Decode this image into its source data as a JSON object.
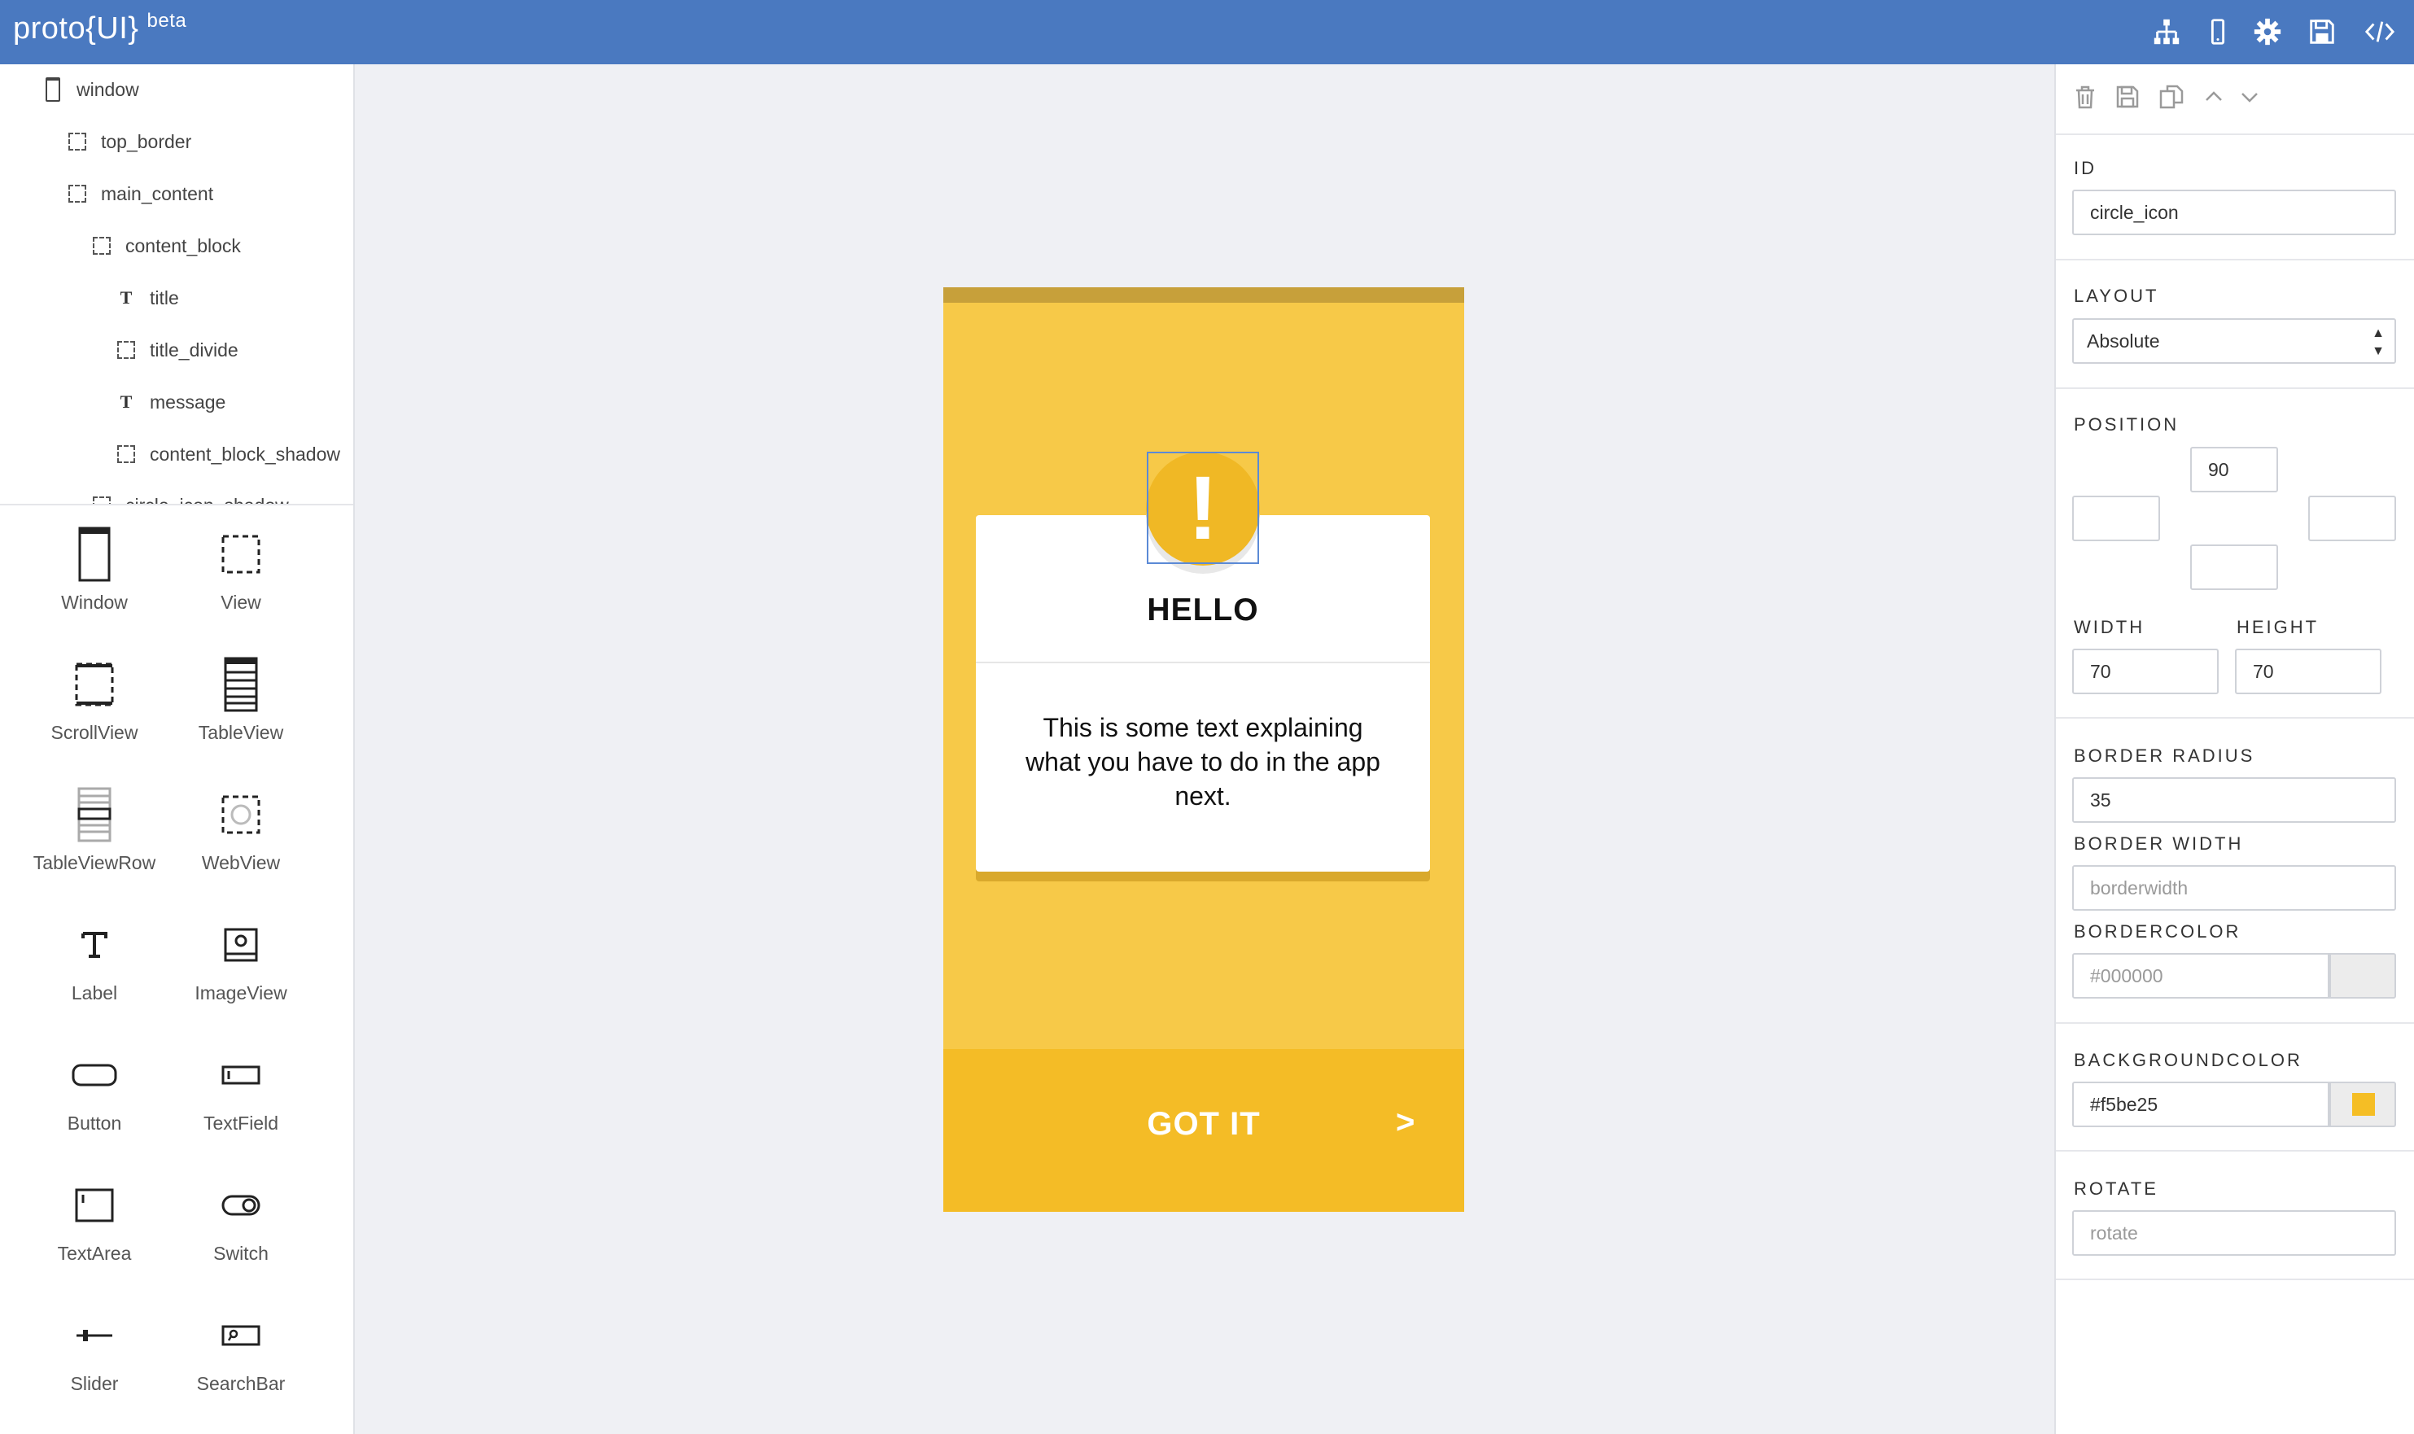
{
  "app": {
    "logo_text": "proto{UI}",
    "beta_label": "beta",
    "toolbar_icons": [
      "sitemap-icon",
      "mobile-icon",
      "gear-icon",
      "save-icon",
      "code-icon"
    ]
  },
  "tree": {
    "items": [
      {
        "label": "window",
        "type": "window"
      },
      {
        "label": "top_border",
        "type": "view"
      },
      {
        "label": "main_content",
        "type": "view"
      },
      {
        "label": "content_block",
        "type": "view"
      },
      {
        "label": "title",
        "type": "label"
      },
      {
        "label": "title_divide",
        "type": "view"
      },
      {
        "label": "message",
        "type": "label"
      },
      {
        "label": "content_block_shadow",
        "type": "view"
      },
      {
        "label": "circle_icon_shadow",
        "type": "view"
      }
    ]
  },
  "palette": {
    "items": [
      {
        "label": "Window",
        "icon": "window-icon"
      },
      {
        "label": "View",
        "icon": "view-icon"
      },
      {
        "label": "ScrollView",
        "icon": "scrollview-icon"
      },
      {
        "label": "TableView",
        "icon": "tableview-icon"
      },
      {
        "label": "TableViewRow",
        "icon": "tableviewrow-icon"
      },
      {
        "label": "WebView",
        "icon": "webview-icon"
      },
      {
        "label": "Label",
        "icon": "label-icon"
      },
      {
        "label": "ImageView",
        "icon": "imageview-icon"
      },
      {
        "label": "Button",
        "icon": "button-icon"
      },
      {
        "label": "TextField",
        "icon": "textfield-icon"
      },
      {
        "label": "TextArea",
        "icon": "textarea-icon"
      },
      {
        "label": "Switch",
        "icon": "switch-icon"
      },
      {
        "label": "Slider",
        "icon": "slider-icon"
      },
      {
        "label": "SearchBar",
        "icon": "searchbar-icon"
      }
    ]
  },
  "preview": {
    "title": "HELLO",
    "exclamation": "!",
    "message": "This is some text explaining what you have to do in the app next.",
    "button_label": "GOT IT",
    "button_arrow": ">",
    "colors": {
      "background": "#f7c948",
      "top_border": "#c7a03a",
      "button": "#f4bc26",
      "circle": "#f0b825"
    }
  },
  "properties": {
    "toolbar_icons": [
      "trash-icon",
      "save-icon",
      "copy-icon",
      "chevron-up-icon",
      "chevron-down-icon"
    ],
    "id_label": "ID",
    "id_value": "circle_icon",
    "layout_label": "LAYOUT",
    "layout_value": "Absolute",
    "position_label": "POSITION",
    "position_top": "90",
    "position_left": "",
    "position_right": "",
    "position_bottom": "",
    "width_label": "WIDTH",
    "width_value": "70",
    "height_label": "HEIGHT",
    "height_value": "70",
    "border_radius_label": "BORDER RADIUS",
    "border_radius_value": "35",
    "border_width_label": "BORDER WIDTH",
    "border_width_placeholder": "borderwidth",
    "bordercolor_label": "BORDERCOLOR",
    "bordercolor_placeholder": "#000000",
    "backgroundcolor_label": "BACKGROUNDCOLOR",
    "backgroundcolor_value": "#f5be25",
    "rotate_label": "ROTATE",
    "rotate_placeholder": "rotate"
  }
}
